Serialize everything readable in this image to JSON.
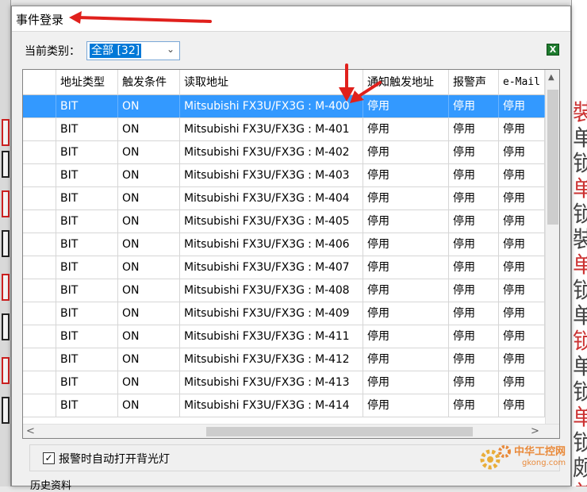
{
  "window": {
    "title": "事件登录"
  },
  "filter": {
    "label": "当前类别：",
    "selected": "全部 [32]"
  },
  "table": {
    "columns": [
      "",
      "地址类型",
      "触发条件",
      "读取地址",
      "通知触发地址",
      "报警声",
      "e-Mail"
    ],
    "rows": [
      {
        "type": "BIT",
        "cond": "ON",
        "addr": "Mitsubishi FX3U/FX3G : M-400",
        "notify": "停用",
        "sound": "停用",
        "email": "停用",
        "selected": true
      },
      {
        "type": "BIT",
        "cond": "ON",
        "addr": "Mitsubishi FX3U/FX3G : M-401",
        "notify": "停用",
        "sound": "停用",
        "email": "停用"
      },
      {
        "type": "BIT",
        "cond": "ON",
        "addr": "Mitsubishi FX3U/FX3G : M-402",
        "notify": "停用",
        "sound": "停用",
        "email": "停用"
      },
      {
        "type": "BIT",
        "cond": "ON",
        "addr": "Mitsubishi FX3U/FX3G : M-403",
        "notify": "停用",
        "sound": "停用",
        "email": "停用"
      },
      {
        "type": "BIT",
        "cond": "ON",
        "addr": "Mitsubishi FX3U/FX3G : M-404",
        "notify": "停用",
        "sound": "停用",
        "email": "停用"
      },
      {
        "type": "BIT",
        "cond": "ON",
        "addr": "Mitsubishi FX3U/FX3G : M-405",
        "notify": "停用",
        "sound": "停用",
        "email": "停用"
      },
      {
        "type": "BIT",
        "cond": "ON",
        "addr": "Mitsubishi FX3U/FX3G : M-406",
        "notify": "停用",
        "sound": "停用",
        "email": "停用"
      },
      {
        "type": "BIT",
        "cond": "ON",
        "addr": "Mitsubishi FX3U/FX3G : M-407",
        "notify": "停用",
        "sound": "停用",
        "email": "停用"
      },
      {
        "type": "BIT",
        "cond": "ON",
        "addr": "Mitsubishi FX3U/FX3G : M-408",
        "notify": "停用",
        "sound": "停用",
        "email": "停用"
      },
      {
        "type": "BIT",
        "cond": "ON",
        "addr": "Mitsubishi FX3U/FX3G : M-409",
        "notify": "停用",
        "sound": "停用",
        "email": "停用"
      },
      {
        "type": "BIT",
        "cond": "ON",
        "addr": "Mitsubishi FX3U/FX3G : M-411",
        "notify": "停用",
        "sound": "停用",
        "email": "停用"
      },
      {
        "type": "BIT",
        "cond": "ON",
        "addr": "Mitsubishi FX3U/FX3G : M-412",
        "notify": "停用",
        "sound": "停用",
        "email": "停用"
      },
      {
        "type": "BIT",
        "cond": "ON",
        "addr": "Mitsubishi FX3U/FX3G : M-413",
        "notify": "停用",
        "sound": "停用",
        "email": "停用"
      },
      {
        "type": "BIT",
        "cond": "ON",
        "addr": "Mitsubishi FX3U/FX3G : M-414",
        "notify": "停用",
        "sound": "停用",
        "email": "停用"
      }
    ]
  },
  "options": {
    "backlight_label": "报警时自动打开背光灯",
    "backlight_checked": "✓"
  },
  "history": {
    "label": "历史资料"
  },
  "watermark": {
    "cn": "中华工控网",
    "en": "gkong.com"
  },
  "background": {
    "right_glyphs": [
      "裝",
      "单",
      "锁",
      "单",
      "锁",
      "裝",
      "单",
      "锁",
      "单",
      "锁",
      "单",
      "锁",
      "单",
      "锁",
      "颇",
      "单"
    ]
  },
  "colors": {
    "selection": "#3399ff",
    "annotation_arrow": "#e0201c",
    "export_icon": "#1e7b2e"
  }
}
